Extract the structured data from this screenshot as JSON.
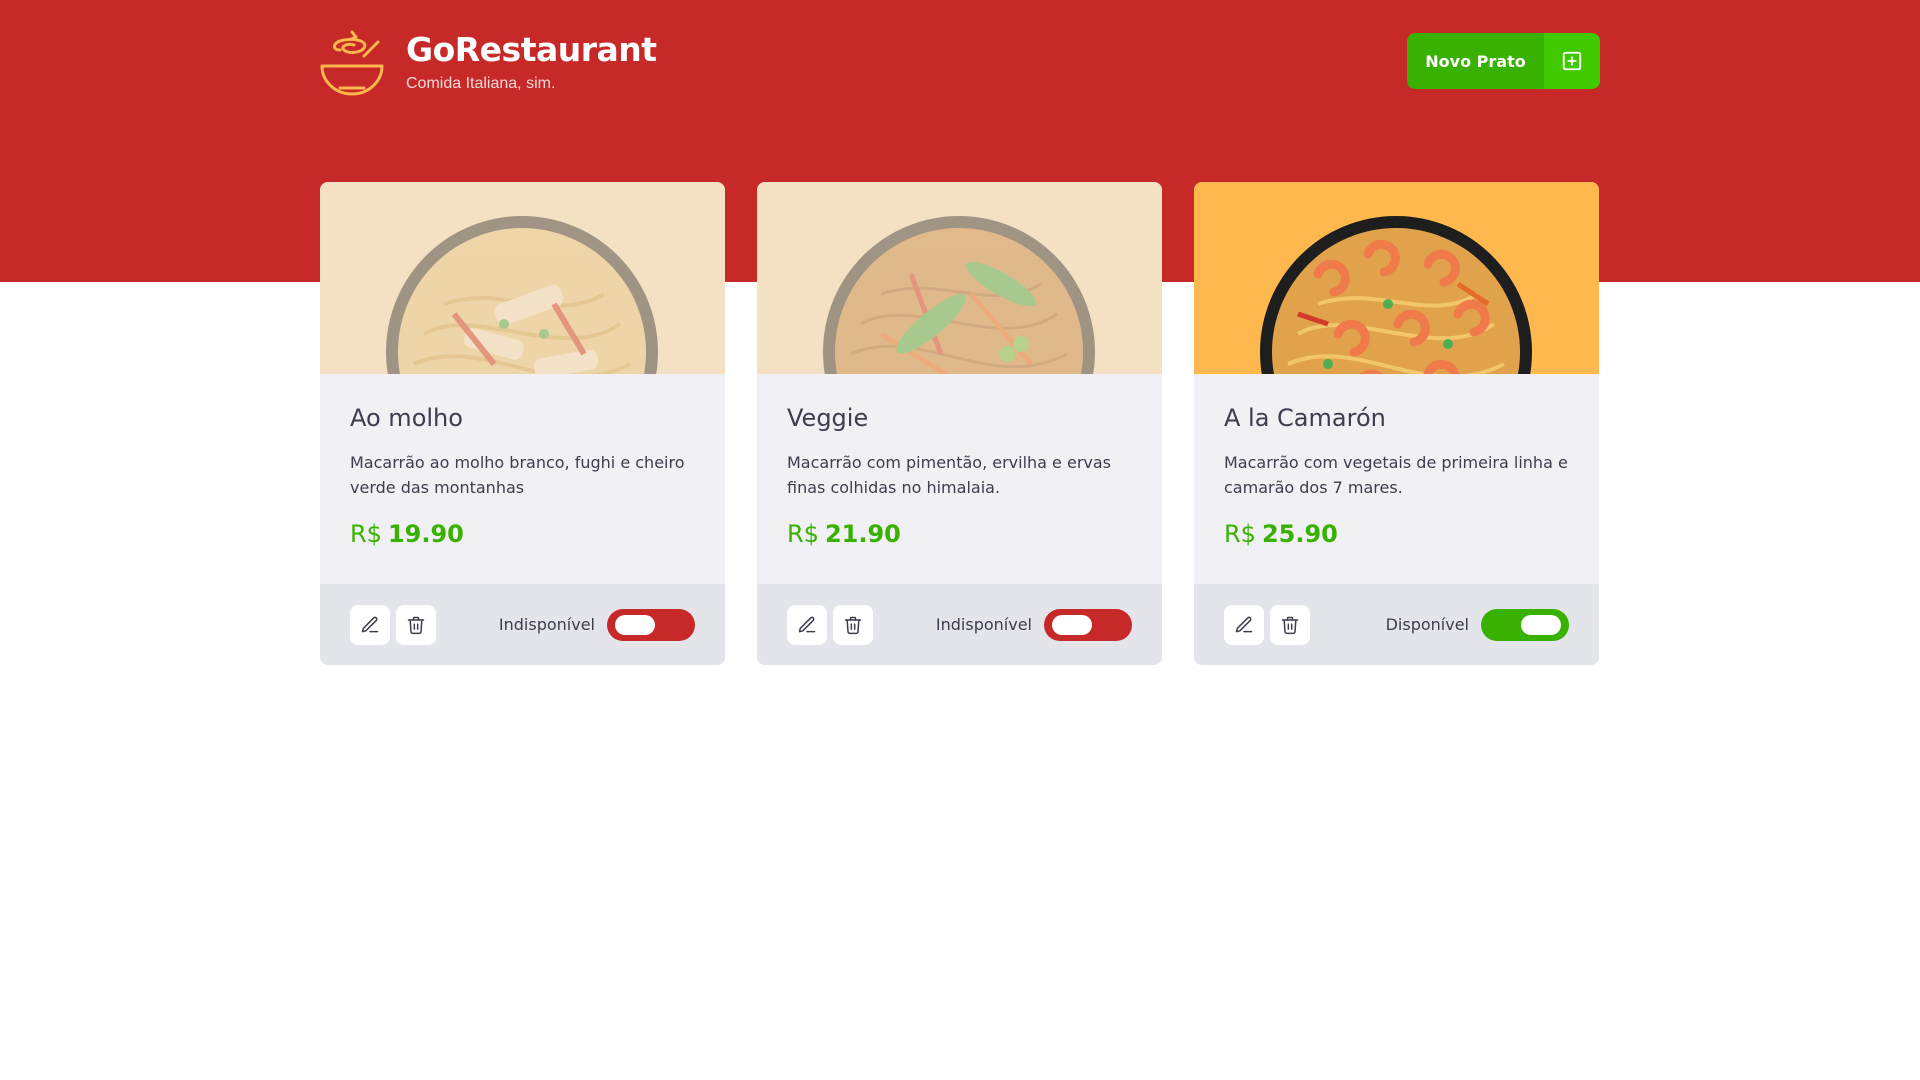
{
  "app": {
    "title": "GoRestaurant",
    "subtitle": "Comida Italiana, sim."
  },
  "header": {
    "new_dish_label": "Novo Prato",
    "new_dish_icon": "plus-square-icon"
  },
  "colors": {
    "brand_red": "#c72828",
    "brand_green": "#39b100",
    "light_green": "#41c900",
    "card_bg": "#f0f0f5",
    "footer_bg": "#e4e4eb",
    "image_bg_available": "#ffb84d",
    "image_bg_unavailable": "#f4e0c2"
  },
  "dishes": [
    {
      "name": "Ao molho",
      "description": "Macarrão ao molho branco, fughi e cheiro verde das montanhas",
      "currency": "R$",
      "price": "19.90",
      "available": false,
      "availability_label": "Indisponível"
    },
    {
      "name": "Veggie",
      "description": "Macarrão com pimentão, ervilha e ervas finas colhidas no himalaia.",
      "currency": "R$",
      "price": "21.90",
      "available": false,
      "availability_label": "Indisponível"
    },
    {
      "name": "A la Camarón",
      "description": "Macarrão com vegetais de primeira linha e camarão dos 7 mares.",
      "currency": "R$",
      "price": "25.90",
      "available": true,
      "availability_label": "Disponível"
    }
  ],
  "icons": {
    "edit": "edit-pencil-icon",
    "delete": "trash-icon"
  }
}
